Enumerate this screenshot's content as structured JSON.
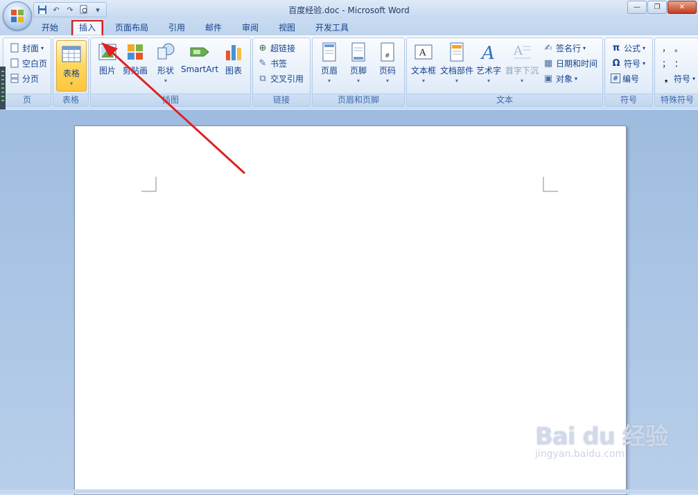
{
  "window": {
    "title": "百度经验.doc - Microsoft Word"
  },
  "tabs": [
    {
      "label": "开始"
    },
    {
      "label": "插入"
    },
    {
      "label": "页面布局"
    },
    {
      "label": "引用"
    },
    {
      "label": "邮件"
    },
    {
      "label": "审阅"
    },
    {
      "label": "视图"
    },
    {
      "label": "开发工具"
    }
  ],
  "ribbon": {
    "page_group": {
      "label": "页",
      "cover": "封面",
      "blank": "空白页",
      "break": "分页"
    },
    "table_group": {
      "label": "表格",
      "table": "表格"
    },
    "illus_group": {
      "label": "插图",
      "picture": "图片",
      "clipart": "剪贴画",
      "shapes": "形状",
      "smartart": "SmartArt",
      "chart": "图表"
    },
    "link_group": {
      "label": "链接",
      "hyperlink": "超链接",
      "bookmark": "书签",
      "crossref": "交叉引用"
    },
    "hf_group": {
      "label": "页眉和页脚",
      "header": "页眉",
      "footer": "页脚",
      "pagenum": "页码"
    },
    "text_group": {
      "label": "文本",
      "textbox": "文本框",
      "quickparts": "文档部件",
      "wordart": "艺术字",
      "dropcap": "首字下沉",
      "sigline": "签名行",
      "datetime": "日期和时间",
      "object": "对象"
    },
    "symbol_group": {
      "label": "符号",
      "equation": "公式",
      "symbol": "符号",
      "number": "编号"
    },
    "special_group": {
      "label": "特殊符号",
      "symbol": "符号",
      "punct1": "，　。",
      "punct2": "；　："
    }
  },
  "watermark": {
    "brand": "Bai du 经验",
    "url": "jingyan.baidu.com"
  },
  "annotation": {
    "color": "#e02020"
  }
}
